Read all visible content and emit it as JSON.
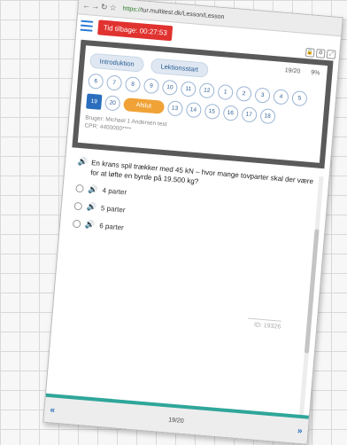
{
  "browser": {
    "url_https": "https://",
    "url_rest": "tur.multitest.dk/Lesson/Lesson"
  },
  "header": {
    "timer_label": "Tid tilbage: 00:27:53"
  },
  "nav_panel": {
    "progress_text": "19/20",
    "progress_percent": "9%",
    "intro_label": "Introduktion",
    "lesson_start_label": "Lektionsstart",
    "row1": [
      "6",
      "7",
      "8",
      "9",
      "10",
      "11",
      "12",
      "1",
      "2",
      "3",
      "4",
      "5"
    ],
    "active_number": "19",
    "row2_before": [
      "20"
    ],
    "finish_label": "Afslut",
    "row2_after": [
      "13",
      "14",
      "15",
      "16",
      "17",
      "18"
    ],
    "user_line": "Bruger: Michael 1 Andersen test",
    "cpr_line": "CPR: 4400000****"
  },
  "question": {
    "text": "En krans spil trækker med 45 kN – hvor mange tovparter skal der være for at løfte en byrde på 19.500 kg?",
    "options": [
      "4 parter",
      "5 parter",
      "6 parter"
    ],
    "id_label": "ID: 19326"
  },
  "footer": {
    "page_text": "19/20",
    "prev_glyph": "«",
    "next_glyph": "»"
  },
  "colors": {
    "timer_bg": "#e0322f",
    "active_blue": "#2a6ebd",
    "finish_orange": "#f0a237",
    "footer_accent": "#2fa69a"
  }
}
